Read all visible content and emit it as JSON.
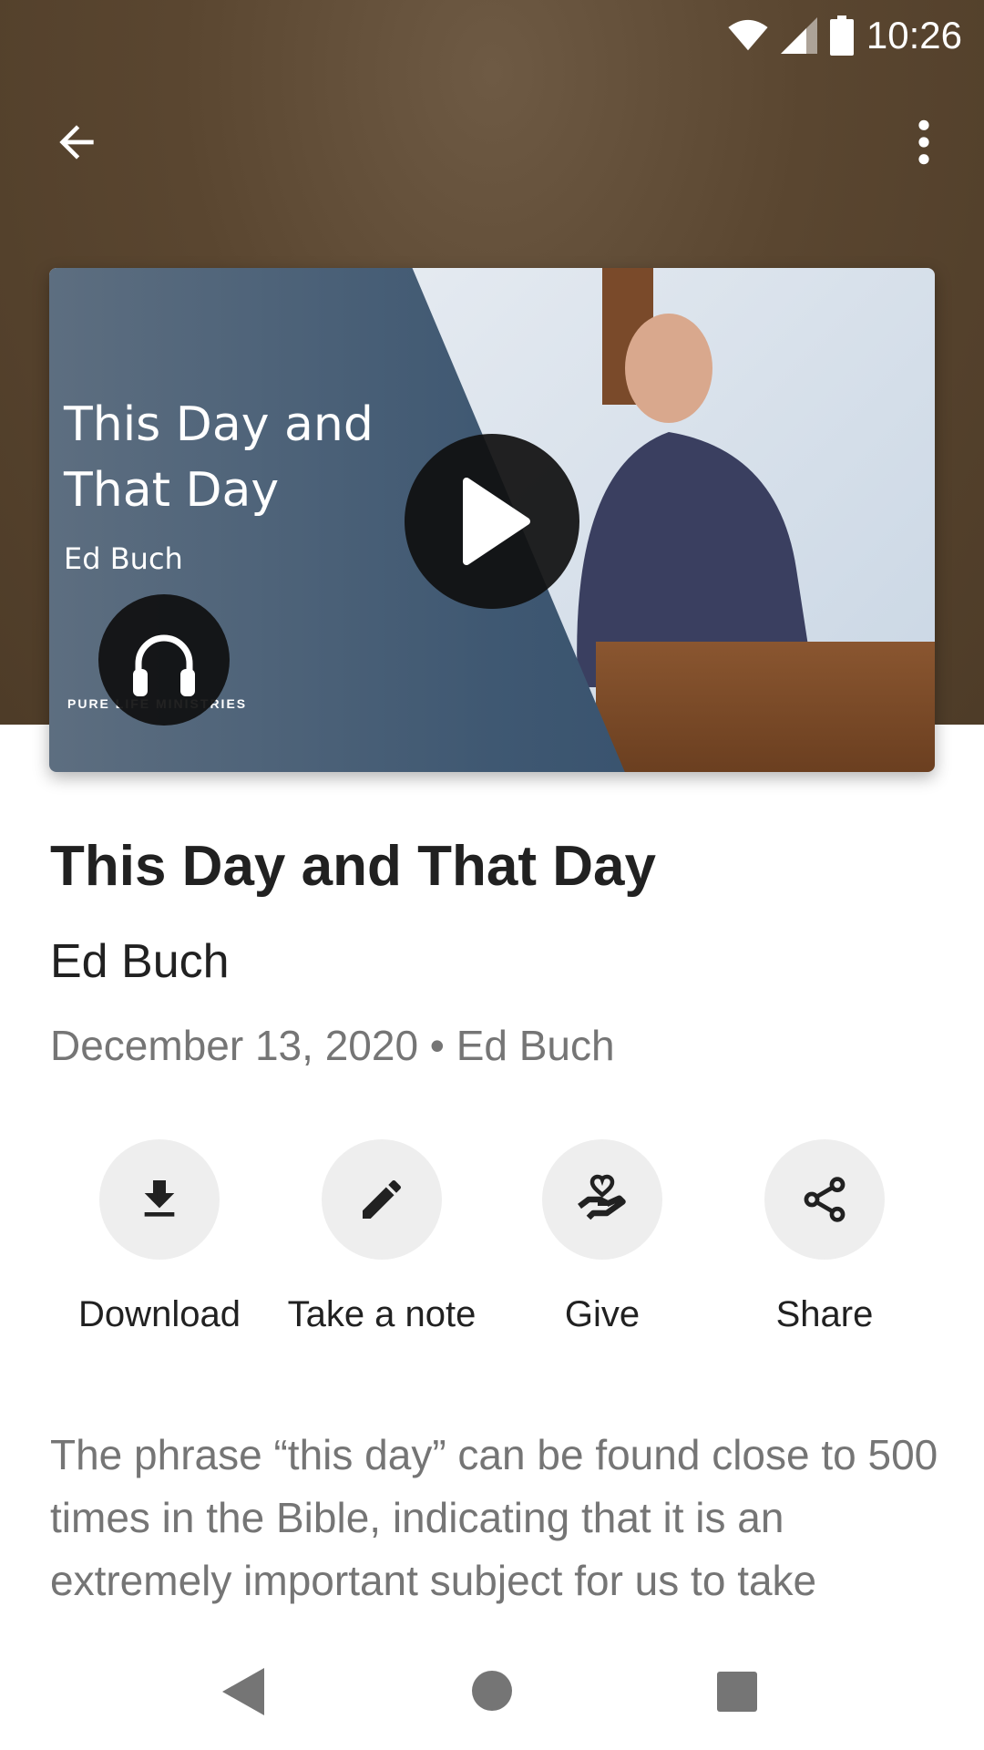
{
  "status_bar": {
    "time": "10:26"
  },
  "header": {
    "back_icon": "arrow-left-icon",
    "menu_icon": "more-vert-icon"
  },
  "thumbnail": {
    "title_line1": "This Day and",
    "title_line2": "That Day",
    "speaker": "Ed Buch",
    "logo_text": "PURE LIFE MINISTRIES"
  },
  "sermon": {
    "title": "This Day and That Day",
    "author": "Ed Buch",
    "meta": "December 13, 2020 • Ed Buch"
  },
  "actions": [
    {
      "label": "Download",
      "icon": "download-icon"
    },
    {
      "label": "Take a note",
      "icon": "pencil-icon"
    },
    {
      "label": "Give",
      "icon": "give-heart-hand-icon"
    },
    {
      "label": "Share",
      "icon": "share-icon"
    }
  ],
  "description": "The phrase “this day” can be found close to 500 times in the Bible, indicating that it is an extremely important subject for us to take",
  "colors": {
    "header_bg": "#5a4630",
    "text_primary": "#212121",
    "text_secondary": "#757575",
    "action_bg": "#eeeeee"
  }
}
